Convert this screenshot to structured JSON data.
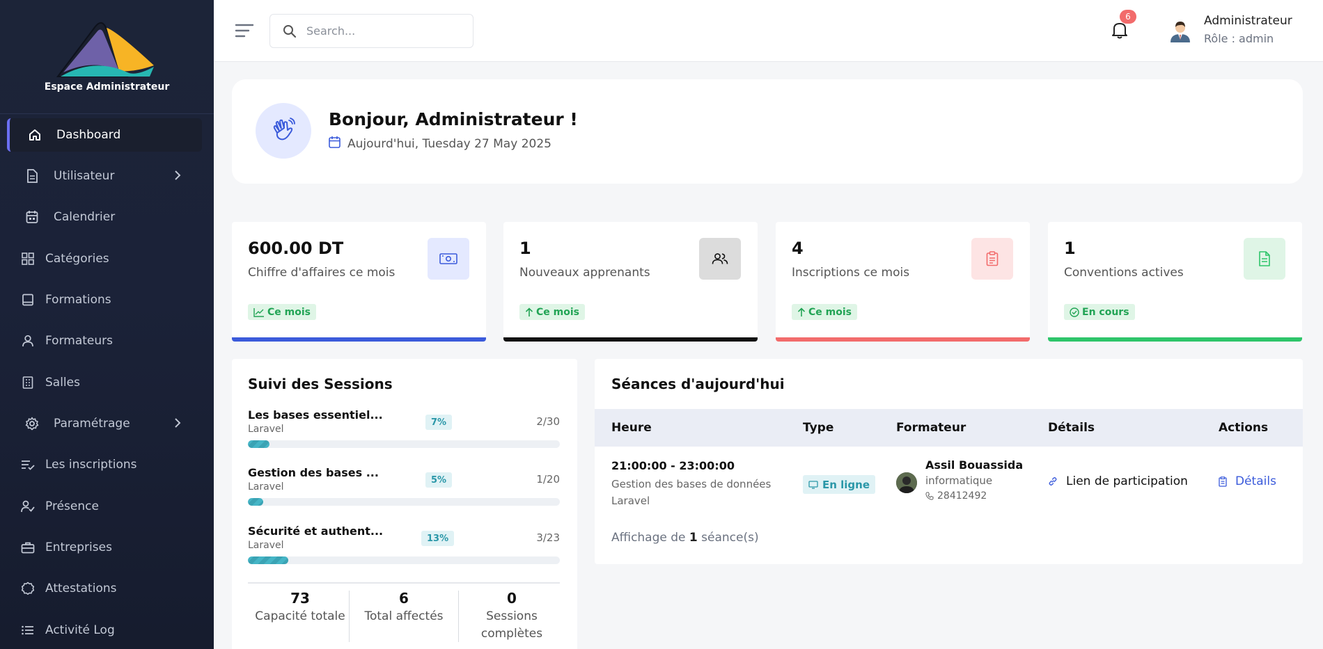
{
  "sidebar": {
    "brand_title": "Espace Administrateur",
    "items": [
      {
        "label": "Dashboard",
        "icon": "home-icon",
        "active": true
      },
      {
        "label": "Utilisateur",
        "icon": "document-icon",
        "has_children": true
      },
      {
        "label": "Calendrier",
        "icon": "calendar-icon"
      },
      {
        "label": "Catégories",
        "icon": "grid-icon"
      },
      {
        "label": "Formations",
        "icon": "book-icon"
      },
      {
        "label": "Formateurs",
        "icon": "user-icon"
      },
      {
        "label": "Salles",
        "icon": "building-icon"
      },
      {
        "label": "Paramétrage",
        "icon": "gear-icon",
        "has_children": true
      },
      {
        "label": "Les inscriptions",
        "icon": "list-check-icon"
      },
      {
        "label": "Présence",
        "icon": "user-check-icon"
      },
      {
        "label": "Entreprises",
        "icon": "briefcase-icon"
      },
      {
        "label": "Attestations",
        "icon": "badge-icon"
      },
      {
        "label": "Activité Log",
        "icon": "list-icon"
      }
    ]
  },
  "topbar": {
    "search_placeholder": "Search...",
    "notification_count": "6",
    "user_name": "Administrateur",
    "user_role": "Rôle : admin"
  },
  "greeting": {
    "title": "Bonjour, Administrateur !",
    "date": "Aujourd'hui, Tuesday 27 May 2025"
  },
  "stats": [
    {
      "value": "600.00 DT",
      "label": "Chiffre d'affaires ce mois",
      "tag": "Ce mois",
      "icon": "money-icon",
      "color": "#3b5bdb"
    },
    {
      "value": "1",
      "label": "Nouveaux apprenants",
      "tag": "Ce mois",
      "icon": "users-icon",
      "color": "#111111"
    },
    {
      "value": "4",
      "label": "Inscriptions ce mois",
      "tag": "Ce mois",
      "icon": "clipboard-icon",
      "color": "#f26b6b"
    },
    {
      "value": "1",
      "label": "Conventions actives",
      "tag": "En cours",
      "icon": "file-icon",
      "color": "#2ec56a"
    }
  ],
  "sessions": {
    "title": "Suivi des Sessions",
    "rows": [
      {
        "name": "Les bases essentiel...",
        "category": "Laravel",
        "percent": "7%",
        "progress": 0.07,
        "count": "2/30"
      },
      {
        "name": "Gestion des bases ...",
        "category": "Laravel",
        "percent": "5%",
        "progress": 0.05,
        "count": "1/20"
      },
      {
        "name": "Sécurité et authent...",
        "category": "Laravel",
        "percent": "13%",
        "progress": 0.13,
        "count": "3/23"
      }
    ],
    "summary": [
      {
        "value": "73",
        "label": "Capacité totale"
      },
      {
        "value": "6",
        "label": "Total affectés"
      },
      {
        "value": "0",
        "label": "Sessions complètes"
      }
    ]
  },
  "today": {
    "title": "Séances d'aujourd'hui",
    "columns": [
      "Heure",
      "Type",
      "Formateur",
      "Détails",
      "Actions"
    ],
    "row": {
      "time": "21:00:00 - 23:00:00",
      "course": "Gestion des bases de données Laravel",
      "type": "En ligne",
      "trainer_name": "Assil Bouassida",
      "trainer_domain": "informatique",
      "trainer_phone": "28412492",
      "details_link": "Lien de participation",
      "action": "Détails"
    },
    "footer_prefix": "Affichage de ",
    "footer_count": "1",
    "footer_suffix": " séance(s)"
  },
  "colors": {
    "sidebar_bg": "#1b2238",
    "accent": "#6b6ff5",
    "teal": "#2a97a8",
    "link_blue": "#3b5bdb"
  }
}
